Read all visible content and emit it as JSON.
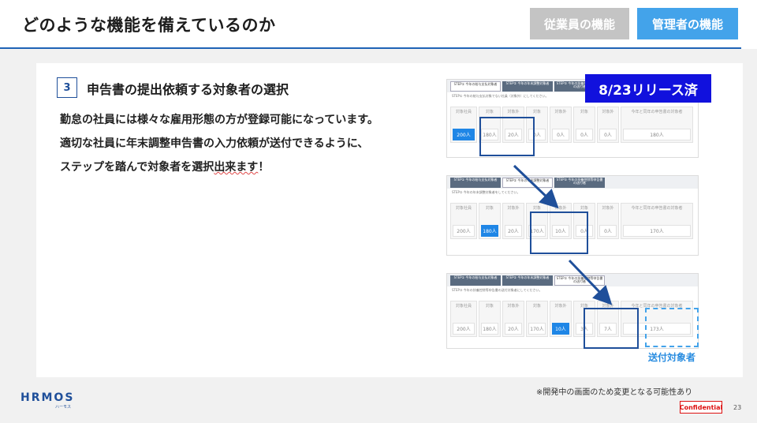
{
  "header": {
    "title": "どのような機能を備えているのか",
    "tab_employee": "従業員の機能",
    "tab_admin": "管理者の機能"
  },
  "section": {
    "step_number": "3",
    "title": "申告書の提出依頼する対象者の選択",
    "desc_line1": "勤怠の社員には様々な雇用形態の方が登録可能になっています。",
    "desc_line2": "適切な社員に年末調整申告書の入力依頼が送付できるように、",
    "desc_line3_pre": "ステップを踏んで対象者を選択",
    "desc_line3_squiggle": "出来ます",
    "desc_line3_post": "！"
  },
  "badges": {
    "release": "8/23リリース済",
    "target_label": "送付対象者"
  },
  "screens": [
    {
      "tabs": [
        "STEP① 今年の給与支払対象者",
        "STEP② 今年の年末調整対象者",
        "STEP③ 今年の扶養控除等申告書の送付者"
      ],
      "note": "STEP① 今年の給与支払対象でない社員（対象外）にしてください。",
      "cells": [
        {
          "label": "対象社員",
          "value": "200人"
        },
        {
          "label": "対象",
          "value": "180人"
        },
        {
          "label": "対象外",
          "value": "20人"
        },
        {
          "label": "対象",
          "value": "0人"
        },
        {
          "label": "対象外",
          "value": "0人"
        },
        {
          "label": "対象",
          "value": "0人"
        },
        {
          "label": "対象外",
          "value": "0人"
        },
        {
          "label": "今年と同年の申告書の対象者",
          "value": "180人"
        }
      ]
    },
    {
      "tabs": [
        "STEP① 今年の給与支払対象者",
        "STEP② 今年の年末調整対象者",
        "STEP③ 今年の扶養控除等申告書の送付者"
      ],
      "note": "STEP② 今年の年末調整対象者をしてください。",
      "cells": [
        {
          "label": "対象社員",
          "value": "200人"
        },
        {
          "label": "対象",
          "value": "180人"
        },
        {
          "label": "対象外",
          "value": "20人"
        },
        {
          "label": "対象",
          "value": "170人"
        },
        {
          "label": "対象外",
          "value": "10人"
        },
        {
          "label": "対象",
          "value": "0人"
        },
        {
          "label": "対象外",
          "value": "0人"
        },
        {
          "label": "今年と同年の申告書の対象者",
          "value": "170人"
        }
      ]
    },
    {
      "tabs": [
        "STEP① 今年の給与支払対象者",
        "STEP② 今年の年末調整対象者",
        "STEP③ 今年の扶養控除等申告書の送付者"
      ],
      "note": "STEP③ 今年の扶養控除等申告書の送付対象者にしてください。",
      "cells": [
        {
          "label": "対象社員",
          "value": "200人"
        },
        {
          "label": "対象",
          "value": "180人"
        },
        {
          "label": "対象外",
          "value": "20人"
        },
        {
          "label": "対象",
          "value": "170人"
        },
        {
          "label": "対象外",
          "value": "10人"
        },
        {
          "label": "対象",
          "value": "3人"
        },
        {
          "label": "対象外",
          "value": "7人"
        },
        {
          "label": "今年と同年の申告書の対象者",
          "value": "173人"
        }
      ]
    }
  ],
  "footer": {
    "logo": "HRMOS",
    "logo_sub": "ハーモス",
    "disclaimer": "※開発中の画面のため変更となる可能性あり",
    "confidential": "Confidential",
    "page": "23"
  },
  "colors": {
    "accent": "#43a3ea",
    "dark_blue": "#1f4f9a",
    "release_bg": "#1111dd"
  }
}
